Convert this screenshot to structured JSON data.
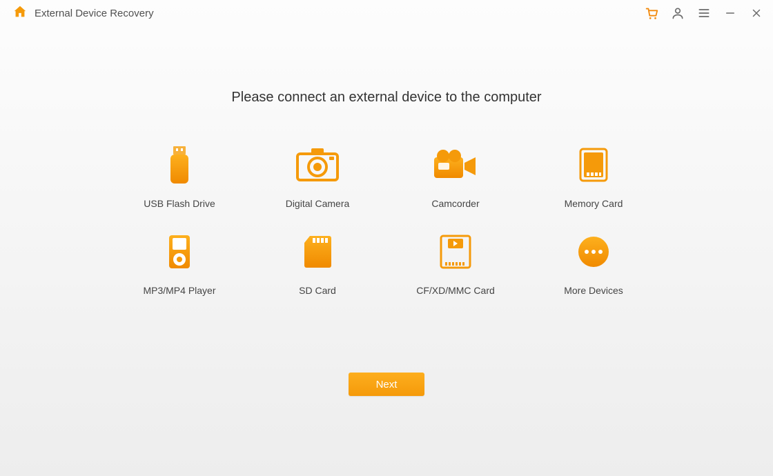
{
  "titlebar": {
    "title": "External Device Recovery"
  },
  "main": {
    "instruction": "Please connect  an external device to the computer"
  },
  "devices": [
    {
      "label": "USB Flash Drive",
      "icon": "usb-flash-drive-icon"
    },
    {
      "label": "Digital Camera",
      "icon": "digital-camera-icon"
    },
    {
      "label": "Camcorder",
      "icon": "camcorder-icon"
    },
    {
      "label": "Memory Card",
      "icon": "memory-card-icon"
    },
    {
      "label": "MP3/MP4 Player",
      "icon": "mp3-player-icon"
    },
    {
      "label": "SD Card",
      "icon": "sd-card-icon"
    },
    {
      "label": "CF/XD/MMC Card",
      "icon": "cf-card-icon"
    },
    {
      "label": "More Devices",
      "icon": "more-devices-icon"
    }
  ],
  "actions": {
    "next": "Next"
  }
}
